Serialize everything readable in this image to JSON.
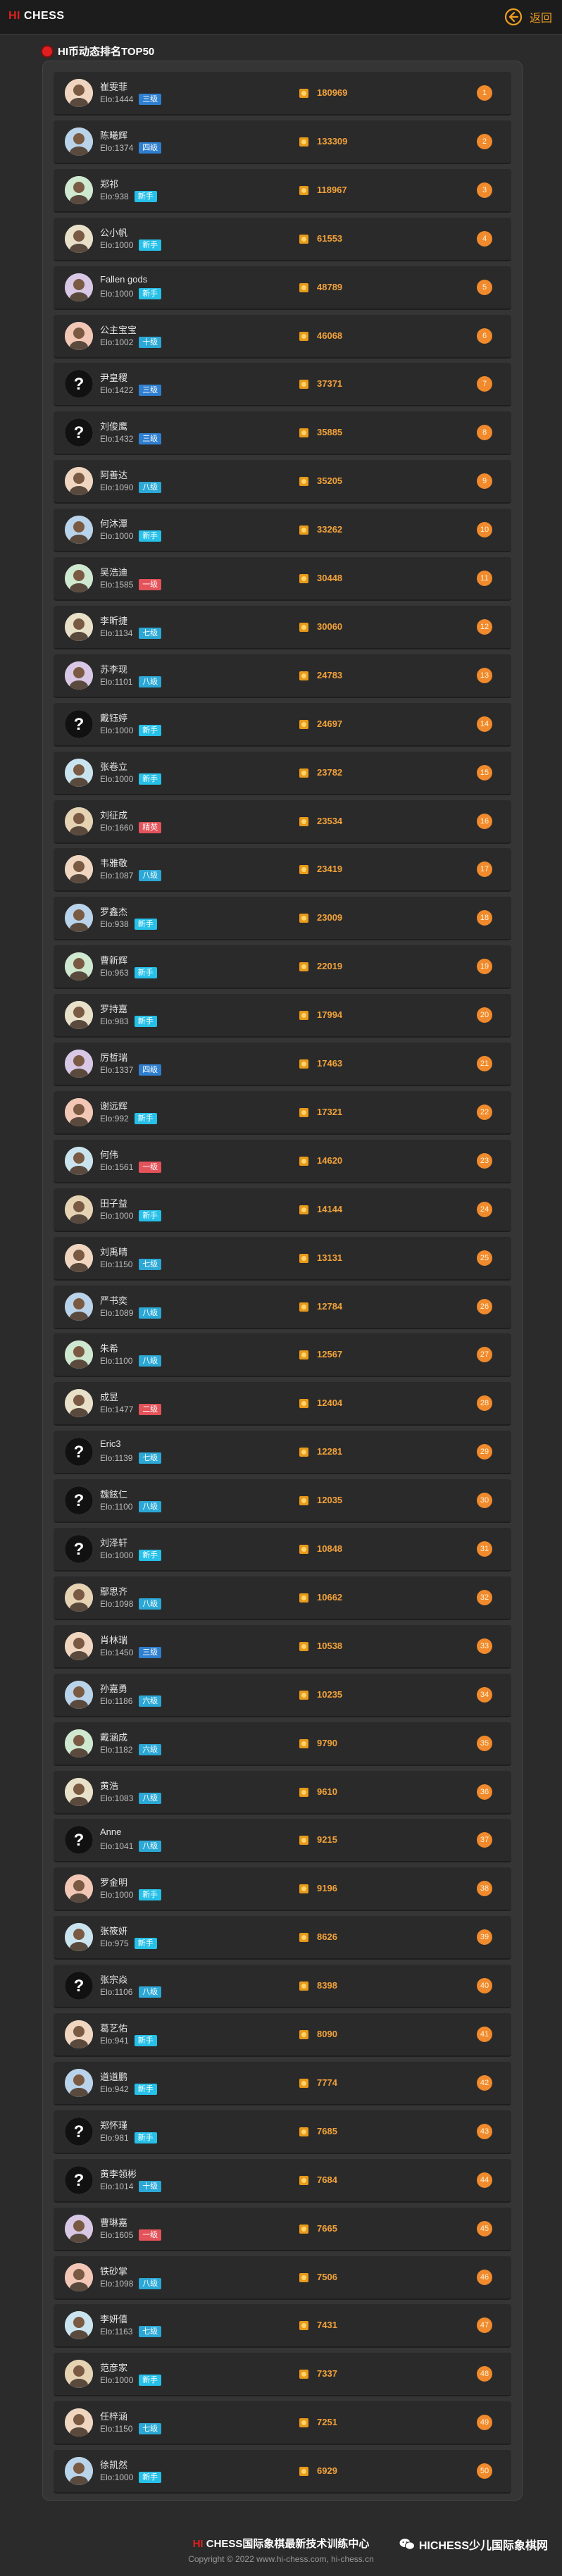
{
  "header": {
    "logo_hi": "HI",
    "logo_rest": " CHESS",
    "back_label": "返回",
    "back_icon": "circle-arrow-left-icon",
    "accent_color": "#f0a020"
  },
  "section": {
    "title": "HI币动态排名TOP50"
  },
  "level_colors": {
    "三级": "#2f7fd0",
    "四级": "#2f7fd0",
    "七级": "#2ba8d6",
    "五级": "#2f7fd0",
    "六级": "#2ba8d6",
    "新手": "#26c0e8",
    "二级": "#e4525a",
    "一级": "#e4525a",
    "精英": "#e4525a",
    "八级": "#2ba8d6"
  },
  "players": [
    {
      "rank": "1",
      "name": "崔雯菲",
      "elo": "Elo:1444",
      "level": "三级",
      "score": "180969",
      "avatar": "user-avatar-icon"
    },
    {
      "rank": "2",
      "name": "陈曦辉",
      "elo": "Elo:1374",
      "level": "四级",
      "score": "133309",
      "avatar": "user-avatar-icon"
    },
    {
      "rank": "3",
      "name": "郑祁",
      "elo": "Elo:938",
      "level": "新手",
      "score": "118967",
      "avatar": "user-avatar-icon"
    },
    {
      "rank": "4",
      "name": "公小帆",
      "elo": "Elo:1000",
      "level": "新手",
      "score": "61553",
      "avatar": "user-avatar-icon"
    },
    {
      "rank": "5",
      "name": "Fallen gods",
      "elo": "Elo:1000",
      "level": "新手",
      "score": "48789",
      "avatar": "user-avatar-icon"
    },
    {
      "rank": "6",
      "name": "公主宝宝",
      "elo": "Elo:1002",
      "level": "十级",
      "score": "46068",
      "avatar": "user-avatar-icon"
    },
    {
      "rank": "7",
      "name": "尹皇稷",
      "elo": "Elo:1422",
      "level": "三级",
      "score": "37371",
      "avatar": "question-avatar-icon"
    },
    {
      "rank": "8",
      "name": "刘俊鹰",
      "elo": "Elo:1432",
      "level": "三级",
      "score": "35885",
      "avatar": "question-avatar-icon"
    },
    {
      "rank": "9",
      "name": "阿善达",
      "elo": "Elo:1090",
      "level": "八级",
      "score": "35205",
      "avatar": "user-avatar-icon"
    },
    {
      "rank": "10",
      "name": "何沐潭",
      "elo": "Elo:1000",
      "level": "新手",
      "score": "33262",
      "avatar": "user-avatar-icon"
    },
    {
      "rank": "11",
      "name": "吴浩迪",
      "elo": "Elo:1585",
      "level": "一级",
      "score": "30448",
      "avatar": "user-avatar-icon"
    },
    {
      "rank": "12",
      "name": "李昕捷",
      "elo": "Elo:1134",
      "level": "七级",
      "score": "30060",
      "avatar": "user-avatar-icon"
    },
    {
      "rank": "13",
      "name": "苏李现",
      "elo": "Elo:1101",
      "level": "八级",
      "score": "24783",
      "avatar": "user-avatar-icon"
    },
    {
      "rank": "14",
      "name": "戴钰婷",
      "elo": "Elo:1000",
      "level": "新手",
      "score": "24697",
      "avatar": "question-avatar-icon"
    },
    {
      "rank": "15",
      "name": "张卷立",
      "elo": "Elo:1000",
      "level": "新手",
      "score": "23782",
      "avatar": "user-avatar-icon"
    },
    {
      "rank": "16",
      "name": "刘征成",
      "elo": "Elo:1660",
      "level": "精英",
      "score": "23534",
      "avatar": "user-avatar-icon"
    },
    {
      "rank": "17",
      "name": "韦雅敬",
      "elo": "Elo:1087",
      "level": "八级",
      "score": "23419",
      "avatar": "user-avatar-icon"
    },
    {
      "rank": "18",
      "name": "罗鑫杰",
      "elo": "Elo:938",
      "level": "新手",
      "score": "23009",
      "avatar": "user-avatar-icon"
    },
    {
      "rank": "19",
      "name": "曹新辉",
      "elo": "Elo:963",
      "level": "新手",
      "score": "22019",
      "avatar": "user-avatar-icon"
    },
    {
      "rank": "20",
      "name": "罗持嘉",
      "elo": "Elo:983",
      "level": "新手",
      "score": "17994",
      "avatar": "user-avatar-icon"
    },
    {
      "rank": "21",
      "name": "厉哲瑞",
      "elo": "Elo:1337",
      "level": "四级",
      "score": "17463",
      "avatar": "user-avatar-icon"
    },
    {
      "rank": "22",
      "name": "谢远辉",
      "elo": "Elo:992",
      "level": "新手",
      "score": "17321",
      "avatar": "user-avatar-icon"
    },
    {
      "rank": "23",
      "name": "何伟",
      "elo": "Elo:1561",
      "level": "一级",
      "score": "14620",
      "avatar": "user-avatar-icon"
    },
    {
      "rank": "24",
      "name": "田子益",
      "elo": "Elo:1000",
      "level": "新手",
      "score": "14144",
      "avatar": "user-avatar-icon"
    },
    {
      "rank": "25",
      "name": "刘禹晴",
      "elo": "Elo:1150",
      "level": "七级",
      "score": "13131",
      "avatar": "user-avatar-icon"
    },
    {
      "rank": "26",
      "name": "严书奕",
      "elo": "Elo:1089",
      "level": "八级",
      "score": "12784",
      "avatar": "user-avatar-icon"
    },
    {
      "rank": "27",
      "name": "朱希",
      "elo": "Elo:1100",
      "level": "八级",
      "score": "12567",
      "avatar": "user-avatar-icon"
    },
    {
      "rank": "28",
      "name": "成昱",
      "elo": "Elo:1477",
      "level": "二级",
      "score": "12404",
      "avatar": "user-avatar-icon"
    },
    {
      "rank": "29",
      "name": "Eric3",
      "elo": "Elo:1139",
      "level": "七级",
      "score": "12281",
      "avatar": "question-avatar-icon"
    },
    {
      "rank": "30",
      "name": "魏鉉仁",
      "elo": "Elo:1100",
      "level": "八级",
      "score": "12035",
      "avatar": "question-avatar-icon"
    },
    {
      "rank": "31",
      "name": "刘泽轩",
      "elo": "Elo:1000",
      "level": "新手",
      "score": "10848",
      "avatar": "question-avatar-icon"
    },
    {
      "rank": "32",
      "name": "鄢思齐",
      "elo": "Elo:1098",
      "level": "八级",
      "score": "10662",
      "avatar": "user-avatar-icon"
    },
    {
      "rank": "33",
      "name": "肖林瑞",
      "elo": "Elo:1450",
      "level": "三级",
      "score": "10538",
      "avatar": "user-avatar-icon"
    },
    {
      "rank": "34",
      "name": "孙嘉勇",
      "elo": "Elo:1186",
      "level": "六级",
      "score": "10235",
      "avatar": "user-avatar-icon"
    },
    {
      "rank": "35",
      "name": "戴涵成",
      "elo": "Elo:1182",
      "level": "六级",
      "score": "9790",
      "avatar": "user-avatar-icon"
    },
    {
      "rank": "36",
      "name": "黄浩",
      "elo": "Elo:1083",
      "level": "八级",
      "score": "9610",
      "avatar": "user-avatar-icon"
    },
    {
      "rank": "37",
      "name": "Anne",
      "elo": "Elo:1041",
      "level": "八级",
      "score": "9215",
      "avatar": "question-avatar-icon"
    },
    {
      "rank": "38",
      "name": "罗金明",
      "elo": "Elo:1000",
      "level": "新手",
      "score": "9196",
      "avatar": "user-avatar-icon"
    },
    {
      "rank": "39",
      "name": "张筱妍",
      "elo": "Elo:975",
      "level": "新手",
      "score": "8626",
      "avatar": "user-avatar-icon"
    },
    {
      "rank": "40",
      "name": "张宗焱",
      "elo": "Elo:1106",
      "level": "八级",
      "score": "8398",
      "avatar": "question-avatar-icon"
    },
    {
      "rank": "41",
      "name": "葛艺佑",
      "elo": "Elo:941",
      "level": "新手",
      "score": "8090",
      "avatar": "user-avatar-icon"
    },
    {
      "rank": "42",
      "name": "道道鹏",
      "elo": "Elo:942",
      "level": "新手",
      "score": "7774",
      "avatar": "user-avatar-icon"
    },
    {
      "rank": "43",
      "name": "郑怀瑾",
      "elo": "Elo:981",
      "level": "新手",
      "score": "7685",
      "avatar": "question-avatar-icon"
    },
    {
      "rank": "44",
      "name": "黄李领彬",
      "elo": "Elo:1014",
      "level": "十级",
      "score": "7684",
      "avatar": "question-avatar-icon"
    },
    {
      "rank": "45",
      "name": "曹琳嘉",
      "elo": "Elo:1605",
      "level": "一级",
      "score": "7665",
      "avatar": "user-avatar-icon"
    },
    {
      "rank": "46",
      "name": "铁砂掌",
      "elo": "Elo:1098",
      "level": "八级",
      "score": "7506",
      "avatar": "user-avatar-icon"
    },
    {
      "rank": "47",
      "name": "李妍僖",
      "elo": "Elo:1163",
      "level": "七级",
      "score": "7431",
      "avatar": "user-avatar-icon"
    },
    {
      "rank": "48",
      "name": "范彦家",
      "elo": "Elo:1000",
      "level": "新手",
      "score": "7337",
      "avatar": "user-avatar-icon"
    },
    {
      "rank": "49",
      "name": "任梓涵",
      "elo": "Elo:1150",
      "level": "七级",
      "score": "7251",
      "avatar": "user-avatar-icon"
    },
    {
      "rank": "50",
      "name": "徐凯然",
      "elo": "Elo:1000",
      "level": "新手",
      "score": "6929",
      "avatar": "user-avatar-icon"
    }
  ],
  "footer": {
    "brand_hi": "HI",
    "brand_rest": " CHESS国际象棋最新技术训练中心",
    "copyright": "Copyright © 2022 www.hi-chess.com, hi-chess.cn",
    "watermark": "HICHESS少儿国际象棋网",
    "watermark_icon": "wechat-icon"
  }
}
